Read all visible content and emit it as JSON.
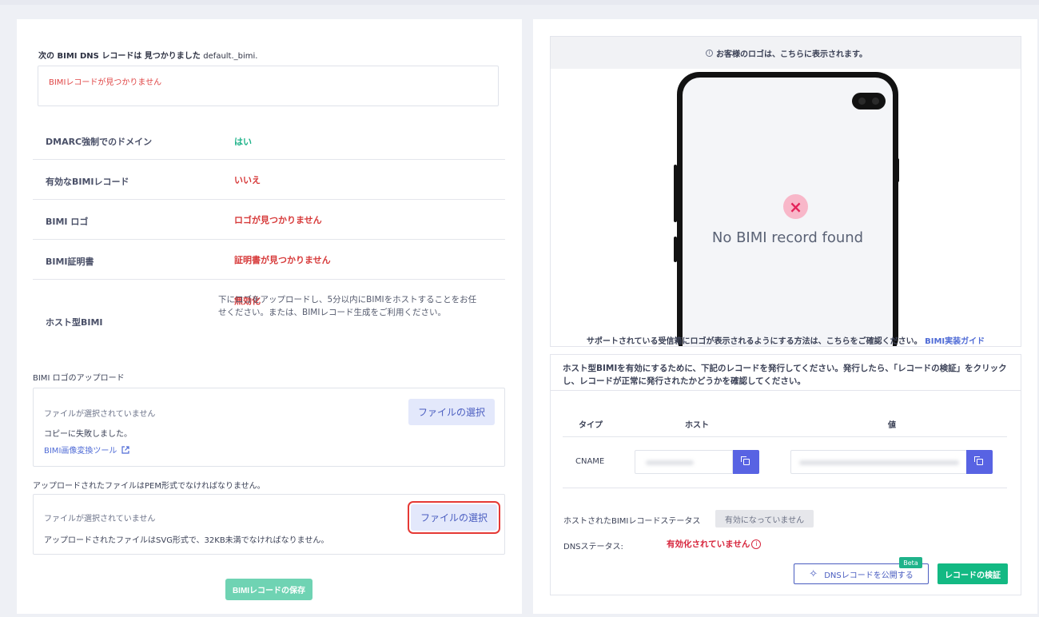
{
  "left": {
    "found_prefix": "次の BIMI DNS レコードは 見つかりました ",
    "found_domain": "default._bimi.",
    "record_box_text": "BIMIレコードが見つかりません",
    "status_rows": [
      {
        "label": "DMARC強制でのドメイン",
        "value": "はい"
      },
      {
        "label": "有効なBIMIレコード",
        "value": "いいえ"
      },
      {
        "label": "BIMI ロゴ",
        "value": "ロゴが見つかりません"
      },
      {
        "label": "BIMI証明書",
        "value": "証明書が見つかりません"
      },
      {
        "label": "ホスト型BIMI",
        "value": "無効化"
      }
    ],
    "hosted_desc": "下にロゴをアップロードし、5分以内にBIMIをホストすることをお任せください。または、BIMIレコード生成をご利用ください。",
    "logo_upload_title": "BIMI ロゴのアップロード",
    "logo_upload": {
      "no_file": "ファイルが選択されていません",
      "choose_label": "ファイルの選択",
      "copy_failed": "コピーに失敗しました。",
      "converter_link": "BIMI画像変換ツール"
    },
    "pem_note": "アップロードされたファイルはPEM形式でなければなりません。",
    "cert_upload": {
      "no_file": "ファイルが選択されていません",
      "choose_label": "ファイルの選択",
      "svg_note": "アップロードされたファイルはSVG形式で、32KB未満でなければなりません。"
    },
    "save_label": "BIMIレコードの保存"
  },
  "right": {
    "preview_header": "お客様のロゴは、こちらに表示されます。",
    "phone_message": "No BIMI record found",
    "support_text": "サポートされている受信箱にロゴが表示されるようにする方法は、こちらをご確認ください。",
    "guide_link": "BIMI実装ガイド",
    "hosted_instructions": "ホスト型BIMIを有効にするために、下記のレコードを発行してください。発行したら、「レコードの検証」をクリックし、レコードが正常に発行されたかどうかを確認してください。",
    "table": {
      "headers": [
        "タイプ",
        "ホスト",
        "値"
      ],
      "row": {
        "type": "CNAME"
      }
    },
    "hosted_status_label": "ホストされたBIMIレコードステータス",
    "hosted_status_value": "有効になっていません",
    "dns_status_label": "DNSステータス:",
    "dns_status_value": "有効化されていません",
    "publish_label": "DNSレコードを公開する",
    "beta_label": "Beta",
    "verify_label": "レコードの検証"
  },
  "colors": {
    "success": "#1fb38a",
    "danger": "#d73a3a",
    "primary": "#5863e3",
    "verify": "#13b983"
  }
}
